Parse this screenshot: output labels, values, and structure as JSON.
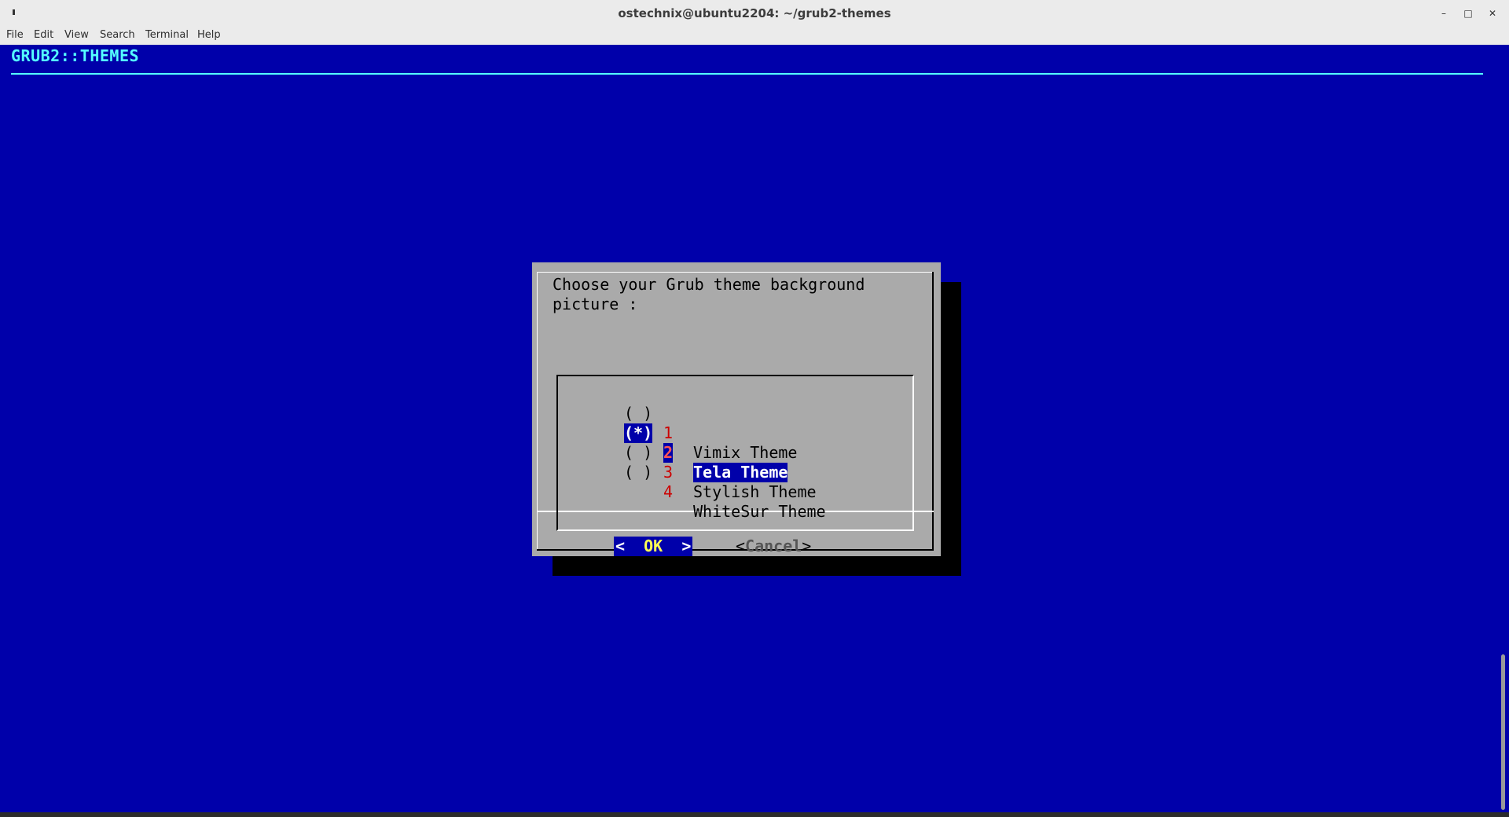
{
  "window": {
    "title": "ostechnix@ubuntu2204: ~/grub2-themes",
    "controls": {
      "minimize": "–",
      "maximize": "□",
      "close": "✕"
    }
  },
  "menubar": {
    "items": [
      "File",
      "Edit",
      "View",
      "Search",
      "Terminal",
      "Help"
    ]
  },
  "terminal": {
    "backtitle": "GRUB2::THEMES",
    "colors": {
      "background": "#0000aa",
      "accent": "#55ffff"
    }
  },
  "dialog": {
    "prompt": "Choose your Grub theme background\npicture :",
    "options": [
      {
        "radio": "( )",
        "number": "1",
        "label": "Vimix Theme",
        "selected": false
      },
      {
        "radio": "(*)",
        "number": "2",
        "label": "Tela Theme",
        "selected": true
      },
      {
        "radio": "( )",
        "number": "3",
        "label": "Stylish Theme",
        "selected": false
      },
      {
        "radio": "( )",
        "number": "4",
        "label": "WhiteSur Theme",
        "selected": false
      }
    ],
    "ok": {
      "left": "<",
      "label": "OK",
      "right": ">"
    },
    "cancel": {
      "left": "<",
      "label": "Cancel",
      "right": ">"
    }
  }
}
